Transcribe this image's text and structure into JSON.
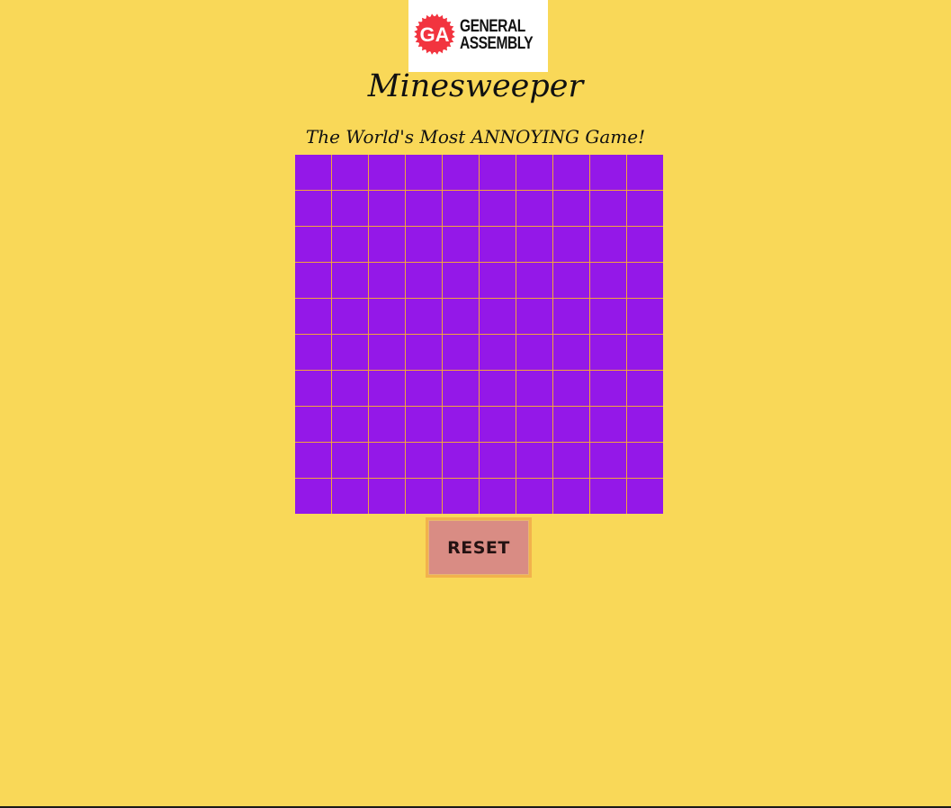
{
  "logo": {
    "monogram": "GA",
    "line1": "GENERAL",
    "line2": "ASSEMBLY",
    "brand_color": "#f2343f"
  },
  "header": {
    "title": "Minesweeper",
    "subtitle": "The World's Most ANNOYING Game!"
  },
  "board": {
    "rows": 10,
    "cols": 10,
    "cell_color": "#9418e8",
    "grid_line_color": "#f2a33b",
    "state": "all cells unrevealed"
  },
  "controls": {
    "reset_label": "RESET"
  },
  "colors": {
    "background": "#f9d858",
    "reset_button": "#d98c84"
  }
}
